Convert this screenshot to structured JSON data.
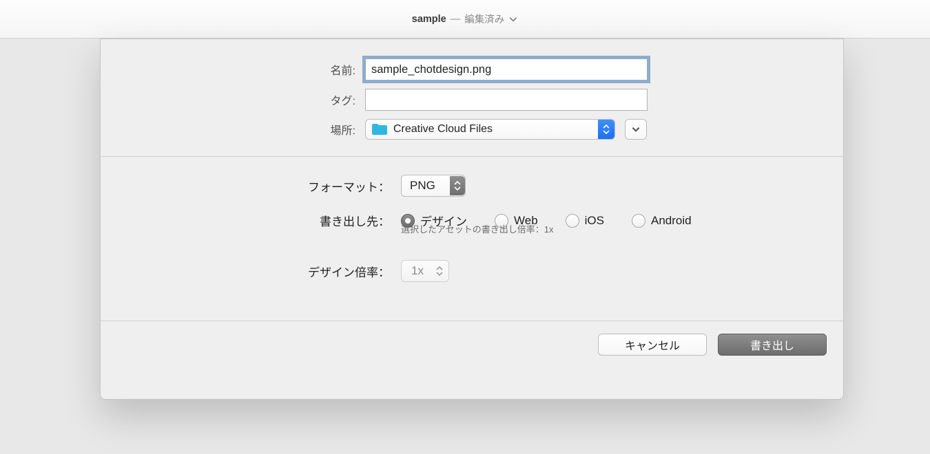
{
  "titlebar": {
    "main": "sample",
    "separator": " — ",
    "status": "編集済み"
  },
  "labels": {
    "name": "名前:",
    "tags": "タグ:",
    "location": "場所:",
    "format": "フォーマット：",
    "exportTo": "書き出し先：",
    "designScale": "デザイン倍率："
  },
  "values": {
    "filename": "sample_chotdesign.png",
    "tags": "",
    "location": "Creative Cloud Files",
    "format": "PNG",
    "designScale": "1x"
  },
  "exportOptions": {
    "opt0": "デザイン",
    "opt1": "Web",
    "opt2": "iOS",
    "opt3": "Android"
  },
  "hint": "選択したアセットの書き出し倍率：1x",
  "buttons": {
    "cancel": "キャンセル",
    "export": "書き出し"
  }
}
